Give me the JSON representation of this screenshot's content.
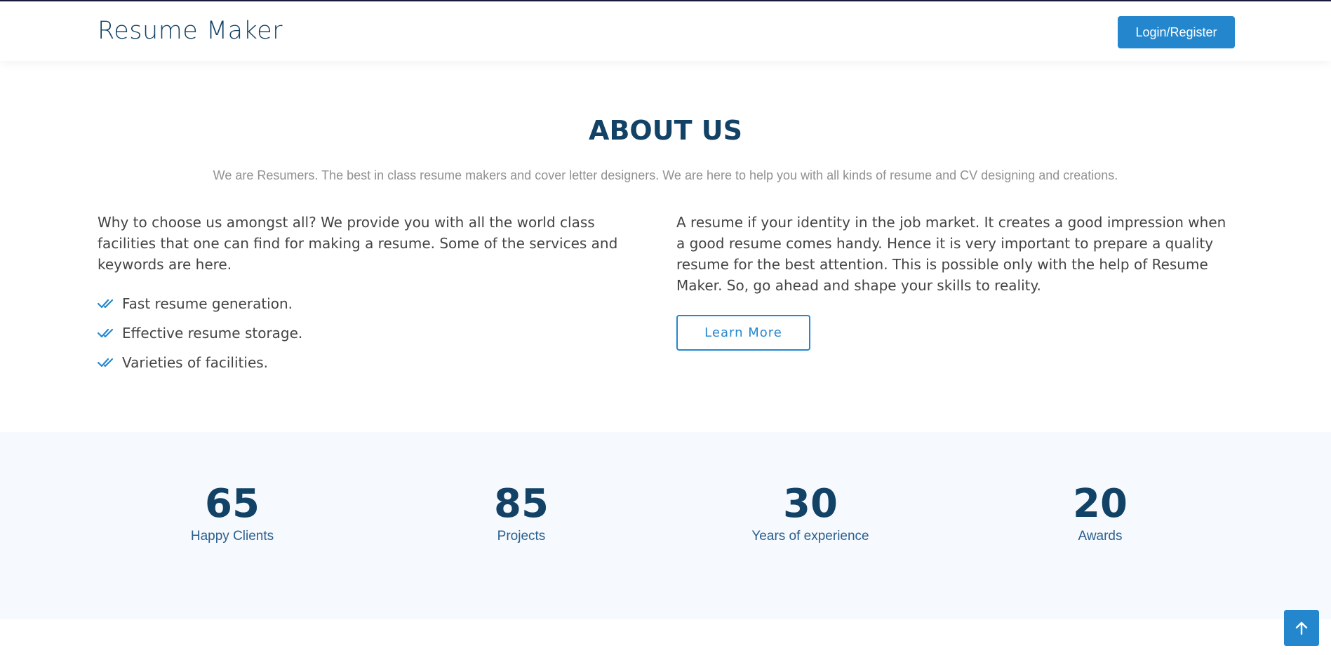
{
  "header": {
    "logo_text": "Resume Maker",
    "login_label": "Login/Register"
  },
  "about": {
    "title": "ABOUT US",
    "subtitle": "We are Resumers. The best in class resume makers and cover letter designers. We are here to help you with all kinds of resume and CV designing and creations.",
    "left_paragraph": "Why to choose us amongst all? We provide you with all the world class facilities that one can find for making a resume. Some of the services and keywords are here.",
    "features": [
      {
        "label": "Fast resume generation.",
        "icon": "double-check-icon"
      },
      {
        "label": "Effective resume storage.",
        "icon": "double-check-icon"
      },
      {
        "label": "Varieties of facilities.",
        "icon": "double-check-icon"
      }
    ],
    "right_paragraph": "A resume if your identity in the job market. It creates a good impression when a good resume comes handy. Hence it is very important to prepare a quality resume for the best attention. This is possible only with the help of Resume Maker. So, go ahead and shape your skills to reality.",
    "learn_more_label": "Learn More"
  },
  "counts": [
    {
      "value": "65",
      "label": "Happy Clients"
    },
    {
      "value": "85",
      "label": "Projects"
    },
    {
      "value": "30",
      "label": "Years of experience"
    },
    {
      "value": "20",
      "label": "Awards"
    }
  ],
  "back_to_top": {
    "icon": "arrow-up-icon"
  },
  "colors": {
    "accent": "#2487ce",
    "heading": "#124265",
    "counts_bg": "#f6f9fd",
    "text": "#444444",
    "muted": "#919191"
  }
}
